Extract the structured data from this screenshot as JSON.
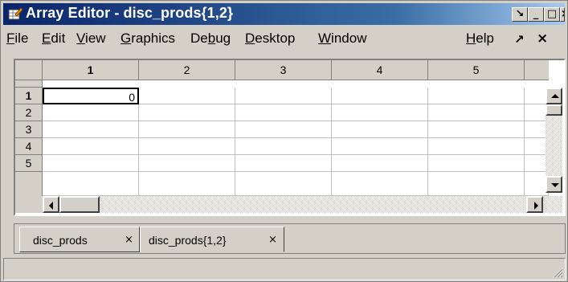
{
  "window": {
    "title": "Array Editor - disc_prods{1,2}",
    "title_icon": "array-editor-icon",
    "controls": {
      "dock": "↘",
      "minimize": "_",
      "maximize": "□",
      "close": "×"
    },
    "accent": "#0a246a"
  },
  "menu": {
    "items": [
      {
        "first": "F",
        "rest": "ile"
      },
      {
        "first": "E",
        "rest": "dit"
      },
      {
        "first": "V",
        "rest": "iew"
      },
      {
        "first": "G",
        "rest": "raphics"
      },
      {
        "pre": "De",
        "first": "b",
        "rest": "ug"
      },
      {
        "first": "D",
        "rest": "esktop"
      },
      {
        "first": "W",
        "rest": "indow"
      },
      {
        "first": "H",
        "rest": "elp"
      }
    ],
    "undock_glyph": "↗",
    "close_glyph": "×"
  },
  "grid": {
    "columns": [
      "1",
      "2",
      "3",
      "4",
      "5"
    ],
    "rows": [
      "1",
      "2",
      "3",
      "4",
      "5"
    ],
    "selected_column": "1",
    "selected_row": "1",
    "active_cell_value": "0"
  },
  "tabs": [
    {
      "label": "disc_prods",
      "close": "×"
    },
    {
      "label": "disc_prods{1,2}",
      "close": "×"
    }
  ]
}
